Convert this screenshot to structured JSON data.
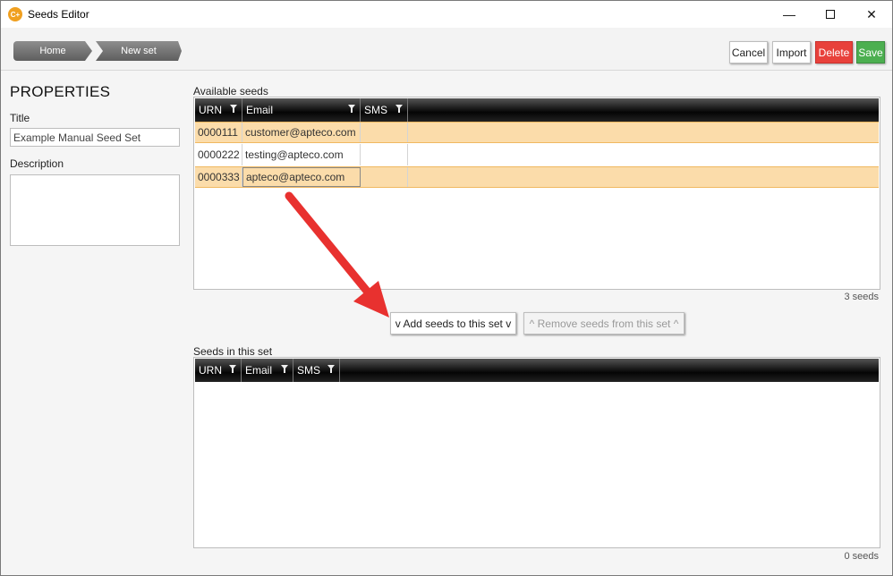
{
  "window": {
    "title": "Seeds Editor",
    "app_icon_glyph": "C+",
    "controls": {
      "minimize": "—",
      "maximize": "",
      "close": "✕"
    }
  },
  "toolbar": {
    "breadcrumbs": [
      "Home",
      "New set"
    ],
    "cancel_label": "Cancel",
    "import_label": "Import",
    "delete_label": "Delete",
    "save_label": "Save"
  },
  "properties": {
    "heading": "PROPERTIES",
    "title_label": "Title",
    "title_value": "Example Manual Seed Set",
    "description_label": "Description",
    "description_value": ""
  },
  "available": {
    "label": "Available seeds",
    "columns": [
      "URN",
      "Email",
      "SMS"
    ],
    "rows": [
      {
        "urn": "0000111",
        "email": "customer@apteco.com",
        "sms": "",
        "highlighted": true
      },
      {
        "urn": "0000222",
        "email": "testing@apteco.com",
        "sms": "",
        "highlighted": false
      },
      {
        "urn": "0000333",
        "email": "apteco@apteco.com",
        "sms": "",
        "highlighted": true
      }
    ],
    "count": "3 seeds"
  },
  "actions": {
    "add_label": "v Add seeds to this set v",
    "remove_label": "^ Remove seeds from this set ^"
  },
  "in_set": {
    "label": "Seeds in this set",
    "columns": [
      "URN",
      "Email",
      "SMS"
    ],
    "count": "0 seeds"
  },
  "colors": {
    "delete": "#e8413b",
    "save": "#4caf50",
    "highlight_row": "#fbdcaa",
    "annotation_arrow": "#e8312f"
  }
}
